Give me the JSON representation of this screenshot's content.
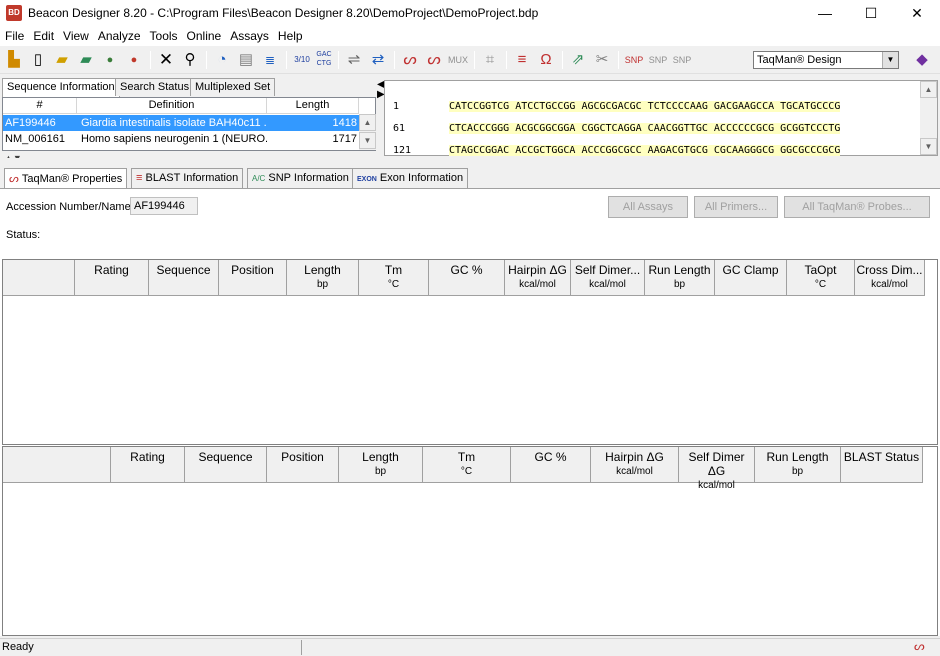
{
  "window": {
    "title": "Beacon Designer 8.20 - C:\\Program Files\\Beacon Designer 8.20\\DemoProject\\DemoProject.bdp",
    "icon_text": "BD",
    "minimize": "—",
    "maximize": "☐",
    "close": "✕"
  },
  "menu": [
    "File",
    "Edit",
    "View",
    "Analyze",
    "Tools",
    "Online",
    "Assays",
    "Help"
  ],
  "toolbar": {
    "assay_select": "TaqMan® Design",
    "icons": [
      "open-folder-icon",
      "new-file-icon",
      "open-project-icon",
      "save-project-icon",
      "genbank-icon",
      "snp-icon",
      "delete-icon",
      "find-icon",
      "taqman-probe-icon",
      "notepad-icon",
      "sequence-icon",
      "count-icon",
      "gac-ctg-icon",
      "align-icon",
      "swap-icon",
      "probe-icon",
      "probe-alt-icon",
      "mux-icon",
      "grid-icon",
      "blast-icon",
      "primer-icon",
      "pair-icon",
      "exon-icon",
      "snp-add-icon",
      "snp-remove-icon",
      "snp-check-icon",
      "book-icon"
    ]
  },
  "top_tabs": [
    "Sequence Information",
    "Search Status",
    "Multiplexed Set"
  ],
  "seq_list": {
    "headers": [
      "#",
      "Definition",
      "Length"
    ],
    "rows": [
      {
        "id": "AF199446",
        "definition": "Giardia intestinalis isolate BAH40c11 ...",
        "length": "1418"
      },
      {
        "id": "NM_006161",
        "definition": "Homo sapiens neurogenin 1 (NEURO...",
        "length": "1717"
      }
    ]
  },
  "seq_viewer": {
    "lines": [
      {
        "num": "1",
        "seq": "CATCCGGTCG ATCCTGCCGG AGCGCGACGC TCTCCCCAAG GACGAAGCCA TGCATGCCCG"
      },
      {
        "num": "61",
        "seq": "CTCACCCGGG ACGCGGCGGA CGGCTCAGGA CAACGGTTGC ACCCCCCGCG GCGGTCCCTG"
      },
      {
        "num": "121",
        "seq": "CTAGCCGGAC ACCGCTGGCA ACCCGGCGCC AAGACGTGCG CGCAAGGGCG GGCGCCCGCG"
      }
    ]
  },
  "prop_tabs": [
    "TaqMan® Properties",
    "BLAST Information",
    "SNP Information",
    "Exon Information"
  ],
  "props": {
    "accession_label": "Accession Number/Name:",
    "accession_value": "AF199446",
    "status_label": "Status:",
    "all_assays": "All Assays",
    "all_primers": "All Primers...",
    "all_probes": "All TaqMan® Probes..."
  },
  "grid1": {
    "headers": [
      {
        "t": ""
      },
      {
        "t": "Rating"
      },
      {
        "t": "Sequence"
      },
      {
        "t": "Position"
      },
      {
        "t": "Length",
        "s": "bp"
      },
      {
        "t": "Tm",
        "s": "°C"
      },
      {
        "t": "GC %"
      },
      {
        "t": "Hairpin ΔG",
        "s": "kcal/mol"
      },
      {
        "t": "Self Dimer...",
        "s": "kcal/mol"
      },
      {
        "t": "Run Length",
        "s": "bp"
      },
      {
        "t": "GC Clamp"
      },
      {
        "t": "TaOpt",
        "s": "°C"
      },
      {
        "t": "Cross Dim...",
        "s": "kcal/mol"
      }
    ]
  },
  "grid2": {
    "headers": [
      {
        "t": ""
      },
      {
        "t": "Rating"
      },
      {
        "t": "Sequence"
      },
      {
        "t": "Position"
      },
      {
        "t": "Length",
        "s": "bp"
      },
      {
        "t": "Tm",
        "s": "°C"
      },
      {
        "t": "GC %"
      },
      {
        "t": "Hairpin ΔG",
        "s": "kcal/mol"
      },
      {
        "t": "Self Dimer ΔG",
        "s": "kcal/mol"
      },
      {
        "t": "Run Length",
        "s": "bp"
      },
      {
        "t": "BLAST Status"
      }
    ]
  },
  "status": {
    "text": "Ready"
  }
}
